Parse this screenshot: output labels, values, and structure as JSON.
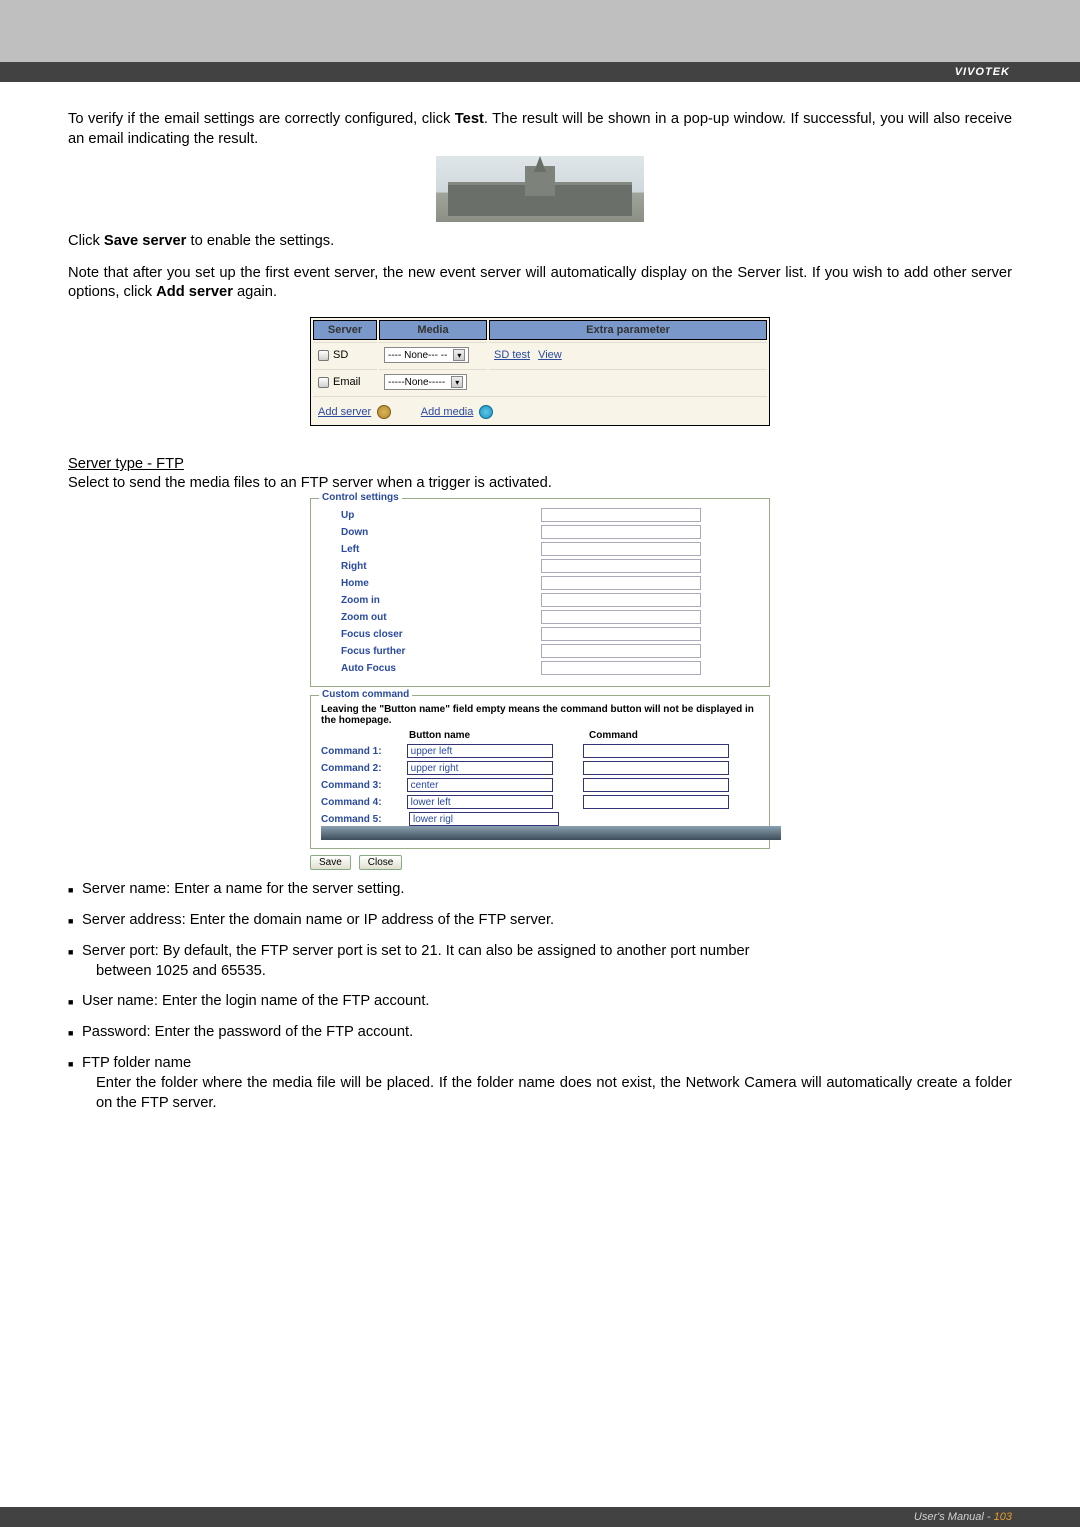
{
  "brand": "VIVOTEK",
  "footer": {
    "label": "User's Manual - ",
    "page": "103"
  },
  "para1": "To verify if the email settings are correctly configured, click Test. The result will be shown in a pop-up window. If successful, you will also receive an email indicating the result.",
  "para2": "Click Save server to enable the settings.",
  "para3": "Note that after you set up the first event server, the new event server will automatically display on the Server list.  If you wish to add other server options, click Add server again.",
  "ftp_heading": "Server type - FTP",
  "ftp_intro": "Select to send the media files to an FTP server when a trigger is activated.",
  "boldbits": {
    "test": "Test",
    "save_server": "Save server",
    "add_server": "Add server"
  },
  "srvTable": {
    "headers": [
      "Server",
      "Media",
      "Extra parameter"
    ],
    "rows": [
      {
        "name": "SD",
        "media": "---- None--- --",
        "extra1": "SD test",
        "extra2": "View"
      },
      {
        "name": "Email",
        "media": "-----None-----",
        "extra1": "",
        "extra2": ""
      }
    ],
    "add_server": "Add server",
    "add_media": "Add media"
  },
  "controlSettings": {
    "legend": "Control settings",
    "rows": [
      "Up",
      "Down",
      "Left",
      "Right",
      "Home",
      "Zoom in",
      "Zoom out",
      "Focus closer",
      "Focus further",
      "Auto Focus"
    ]
  },
  "customCommand": {
    "legend": "Custom command",
    "note": "Leaving the \"Button name\" field empty means the command button will not be displayed in the homepage.",
    "head": [
      "",
      "Button name",
      "Command"
    ],
    "rows": [
      {
        "label": "Command 1:",
        "bname": "upper left"
      },
      {
        "label": "Command 2:",
        "bname": "upper right"
      },
      {
        "label": "Command 3:",
        "bname": "center"
      },
      {
        "label": "Command 4:",
        "bname": "lower left"
      },
      {
        "label": "Command 5:",
        "bname": "lower rigl"
      }
    ],
    "save": "Save",
    "close": "Close"
  },
  "bullets": {
    "b1": "Server name: Enter a name for the server setting.",
    "b2": "Server address: Enter the domain name or IP address of the FTP server.",
    "b3a": "Server port: By default, the FTP server port is set to 21. It can also be assigned to another port number",
    "b3b": "between 1025 and 65535.",
    "b4": "User name: Enter the login name of the FTP account.",
    "b5": "Password: Enter the password of the FTP account.",
    "b6a": "FTP folder name",
    "b6b": "Enter the folder where the media file will be placed. If the folder name does not exist, the Network Camera will automatically create a folder on the FTP server."
  }
}
